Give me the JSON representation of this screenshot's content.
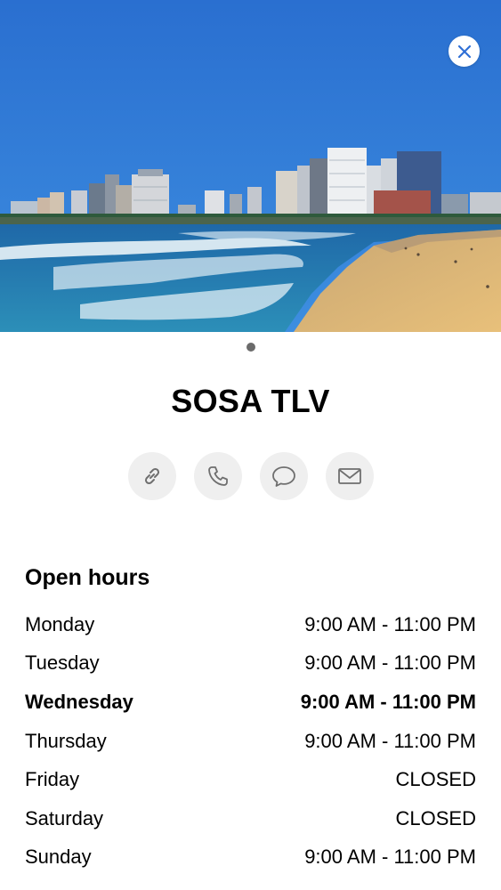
{
  "venue": {
    "name": "SOSA TLV"
  },
  "gallery": {
    "image": "tel-aviv-beach-skyline-photo",
    "current_page": 1,
    "total_pages": 1
  },
  "close": {
    "icon": "close-icon"
  },
  "actions": [
    {
      "icon": "link-icon"
    },
    {
      "icon": "phone-icon"
    },
    {
      "icon": "message-icon"
    },
    {
      "icon": "mail-icon"
    }
  ],
  "hours": {
    "heading": "Open hours",
    "days": [
      {
        "day": "Monday",
        "time": "9:00 AM - 11:00 PM",
        "today": false
      },
      {
        "day": "Tuesday",
        "time": "9:00 AM - 11:00 PM",
        "today": false
      },
      {
        "day": "Wednesday",
        "time": "9:00 AM - 11:00 PM",
        "today": true
      },
      {
        "day": "Thursday",
        "time": "9:00 AM - 11:00 PM",
        "today": false
      },
      {
        "day": "Friday",
        "time": "CLOSED",
        "today": false
      },
      {
        "day": "Saturday",
        "time": "CLOSED",
        "today": false
      },
      {
        "day": "Sunday",
        "time": "9:00 AM - 11:00 PM",
        "today": false
      }
    ]
  },
  "colors": {
    "accent": "#2f6fd6",
    "button_bg": "#efefef",
    "sky": "#2f78d2"
  }
}
